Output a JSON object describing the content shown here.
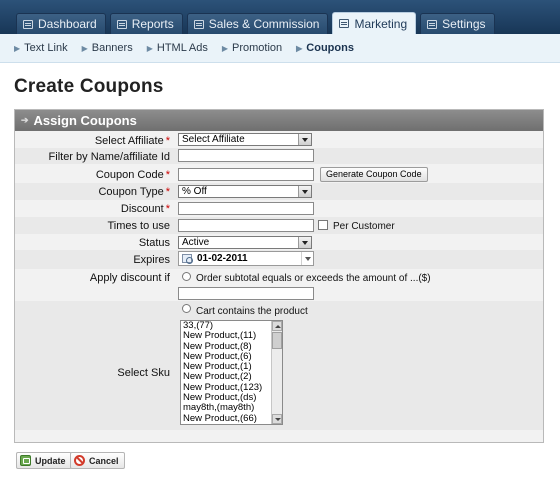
{
  "nav": {
    "tabs": [
      {
        "label": "Dashboard",
        "icon": "dashboard-icon"
      },
      {
        "label": "Reports",
        "icon": "reports-icon"
      },
      {
        "label": "Sales & Commission",
        "icon": "sales-icon"
      },
      {
        "label": "Marketing",
        "icon": "marketing-icon",
        "active": true
      },
      {
        "label": "Settings",
        "icon": "settings-icon"
      }
    ]
  },
  "subnav": {
    "items": [
      {
        "label": "Text Link"
      },
      {
        "label": "Banners"
      },
      {
        "label": "HTML Ads"
      },
      {
        "label": "Promotion"
      },
      {
        "label": "Coupons",
        "active": true
      }
    ]
  },
  "page": {
    "title": "Create Coupons"
  },
  "panel": {
    "title": "Assign Coupons",
    "fields": {
      "select_affiliate": {
        "label": "Select Affiliate",
        "required": "*",
        "value": "Select Affiliate"
      },
      "filter": {
        "label": "Filter by Name/affiliate Id",
        "value": ""
      },
      "coupon_code": {
        "label": "Coupon Code",
        "required": "*",
        "value": "",
        "generate_label": "Generate Coupon Code"
      },
      "coupon_type": {
        "label": "Coupon Type",
        "required": "*",
        "value": "% Off"
      },
      "discount": {
        "label": "Discount",
        "required": "*",
        "value": ""
      },
      "times_to_use": {
        "label": "Times to use",
        "value": "",
        "per_customer_label": "Per Customer"
      },
      "status": {
        "label": "Status",
        "value": "Active"
      },
      "expires": {
        "label": "Expires",
        "value": "01-02-2011"
      },
      "apply_discount": {
        "label": "Apply discount if",
        "option_subtotal": "Order subtotal equals or exceeds the amount of ...($)",
        "subtotal_value": "",
        "option_cart": "Cart contains the product"
      },
      "select_sku": {
        "label": "Select Sku",
        "options": [
          "33,(77)",
          "New Product,(11)",
          "New Product,(8)",
          "New Product,(6)",
          "New Product,(1)",
          "New Product,(2)",
          "New Product,(123)",
          "New Product,(ds)",
          "may8th,(may8th)",
          "New Product,(66)"
        ]
      }
    }
  },
  "footer": {
    "update_label": "Update",
    "cancel_label": "Cancel"
  }
}
